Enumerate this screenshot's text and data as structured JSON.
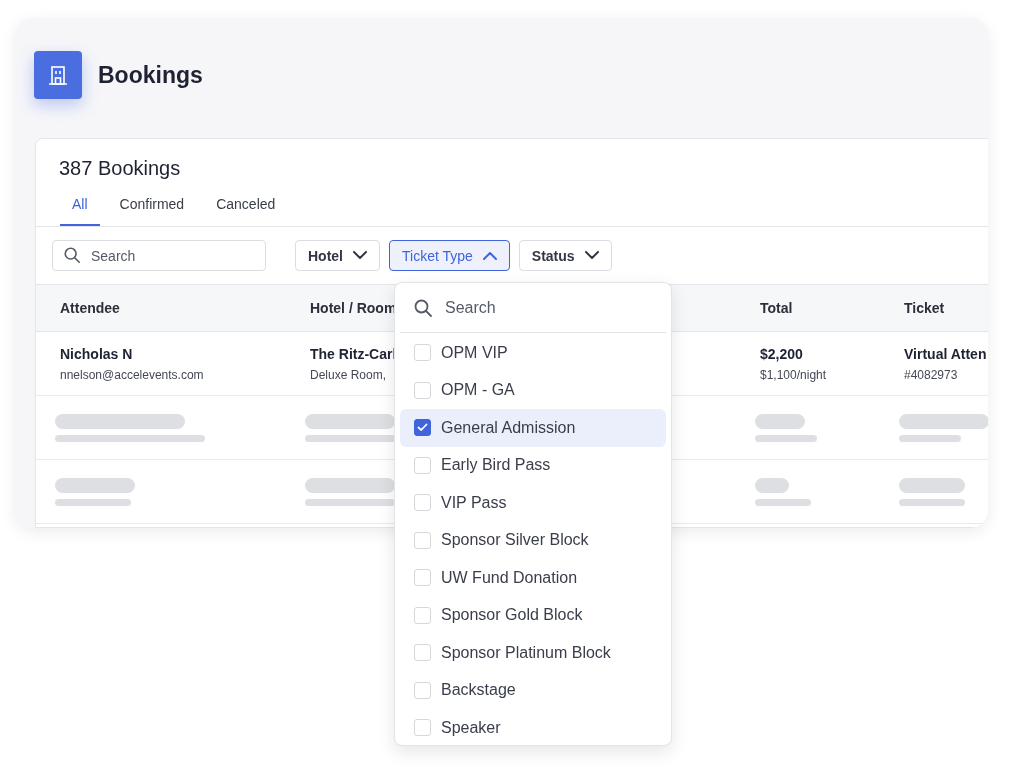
{
  "header": {
    "title": "Bookings"
  },
  "panel": {
    "title": "387 Bookings",
    "tabs": [
      {
        "label": "All",
        "selected": true
      },
      {
        "label": "Confirmed",
        "selected": false
      },
      {
        "label": "Canceled",
        "selected": false
      }
    ],
    "search": {
      "placeholder": "Search"
    },
    "filters": [
      {
        "label": "Hotel",
        "expanded": false
      },
      {
        "label": "Ticket Type",
        "expanded": true
      },
      {
        "label": "Status",
        "expanded": false
      }
    ],
    "table": {
      "columns": [
        "Attendee",
        "Hotel / Room",
        "Total",
        "Ticket"
      ],
      "rows": [
        {
          "kind": "booking",
          "attendee": "Nicholas N",
          "email": "nnelson@accelevents.com",
          "hotel": "The Ritz-Carl",
          "room": "Deluxe Room,",
          "total": "$2,200",
          "rate": "$1,100/night",
          "ticket": "Virtual Atten",
          "ticket_no": "#4082973"
        },
        {
          "kind": "skeleton"
        },
        {
          "kind": "skeleton"
        }
      ]
    }
  },
  "dropdown": {
    "search": {
      "placeholder": "Search"
    },
    "options": [
      {
        "label": "OPM VIP",
        "checked": false
      },
      {
        "label": "OPM - GA",
        "checked": false
      },
      {
        "label": "General Admission",
        "checked": true
      },
      {
        "label": "Early Bird Pass",
        "checked": false
      },
      {
        "label": "VIP Pass",
        "checked": false
      },
      {
        "label": "Sponsor Silver Block",
        "checked": false
      },
      {
        "label": "UW Fund Donation",
        "checked": false
      },
      {
        "label": "Sponsor Gold Block",
        "checked": false
      },
      {
        "label": "Sponsor Platinum Block",
        "checked": false
      },
      {
        "label": "Backstage",
        "checked": false
      },
      {
        "label": "Speaker",
        "checked": false
      }
    ]
  }
}
